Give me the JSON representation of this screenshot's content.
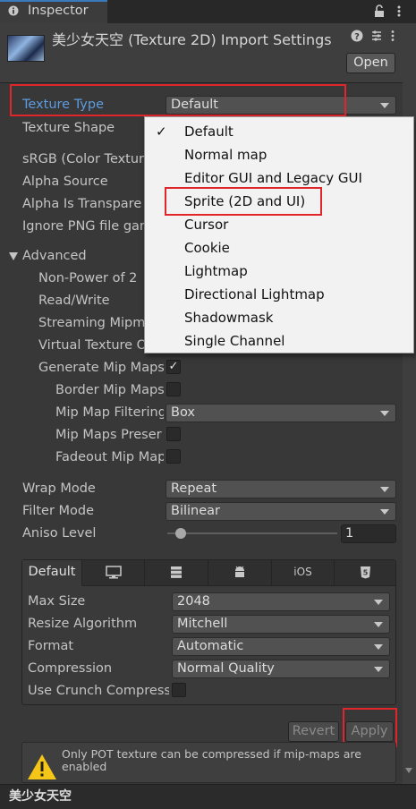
{
  "window": {
    "tab_label": "Inspector"
  },
  "header": {
    "title": "美少女天空 (Texture 2D) Import Settings",
    "open_label": "Open"
  },
  "fields": {
    "texture_type": {
      "label": "Texture Type",
      "value": "Default"
    },
    "texture_shape": {
      "label": "Texture Shape"
    },
    "srgb": {
      "label": "sRGB (Color Textur"
    },
    "alpha_source": {
      "label": "Alpha Source"
    },
    "alpha_is_transparency": {
      "label": "Alpha Is Transpare"
    },
    "ignore_png_gamma": {
      "label": "Ignore PNG file gam"
    },
    "advanced": {
      "label": "Advanced"
    },
    "non_power_of_2": {
      "label": "Non-Power of 2"
    },
    "read_write": {
      "label": "Read/Write"
    },
    "streaming_mipmaps": {
      "label": "Streaming Mipm"
    },
    "virtual_texture": {
      "label": "Virtual Texture O"
    },
    "generate_mip_maps": {
      "label": "Generate Mip Maps",
      "checked": true
    },
    "border_mip_maps": {
      "label": "Border Mip Maps",
      "checked": false
    },
    "mip_map_filtering": {
      "label": "Mip Map Filtering",
      "value": "Box"
    },
    "mip_maps_preserve": {
      "label": "Mip Maps Preser",
      "checked": false
    },
    "fadeout_mip_maps": {
      "label": "Fadeout Mip Map",
      "checked": false
    },
    "wrap_mode": {
      "label": "Wrap Mode",
      "value": "Repeat"
    },
    "filter_mode": {
      "label": "Filter Mode",
      "value": "Bilinear"
    },
    "aniso_level": {
      "label": "Aniso Level",
      "value": "1"
    }
  },
  "dropdown_menu": {
    "items": [
      "Default",
      "Normal map",
      "Editor GUI and Legacy GUI",
      "Sprite (2D and UI)",
      "Cursor",
      "Cookie",
      "Lightmap",
      "Directional Lightmap",
      "Shadowmask",
      "Single Channel"
    ],
    "checked_item": "Default",
    "highlighted_item": "Sprite (2D and UI)",
    "check_glyph": "✓"
  },
  "platform": {
    "tabs": {
      "default": "Default",
      "ios": "iOS"
    },
    "max_size": {
      "label": "Max Size",
      "value": "2048"
    },
    "resize_algorithm": {
      "label": "Resize Algorithm",
      "value": "Mitchell"
    },
    "format": {
      "label": "Format",
      "value": "Automatic"
    },
    "compression": {
      "label": "Compression",
      "value": "Normal Quality"
    },
    "use_crunch": {
      "label": "Use Crunch Compress",
      "checked": false
    }
  },
  "actions": {
    "revert_label": "Revert",
    "apply_label": "Apply"
  },
  "warning": {
    "text": "Only POT texture can be compressed if mip-maps are enabled"
  },
  "footer": {
    "asset_name": "美少女天空"
  },
  "colors": {
    "highlight_red": "#e0252b",
    "accent_blue": "#3a79bb",
    "warning_yellow": "#f5c518"
  }
}
